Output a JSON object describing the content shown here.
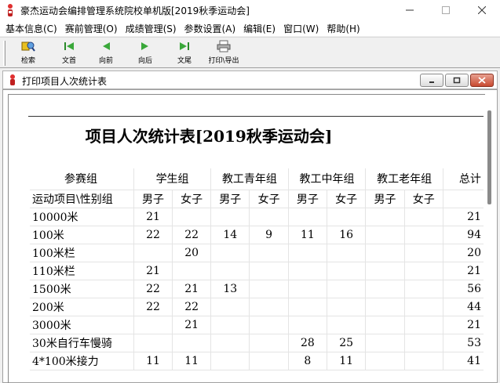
{
  "window": {
    "title": "豪杰运动会编排管理系统院校单机版[2019秋季运动会]"
  },
  "menu": [
    "基本信息(C)",
    "赛前管理(O)",
    "成绩管理(S)",
    "参数设置(A)",
    "编辑(E)",
    "窗口(W)",
    "帮助(H)"
  ],
  "toolbar": {
    "buttons": [
      {
        "label": "检索",
        "icon": "search-icon"
      },
      {
        "label": "文首",
        "icon": "first-record-icon"
      },
      {
        "label": "向前",
        "icon": "previous-icon"
      },
      {
        "label": "向后",
        "icon": "next-icon"
      },
      {
        "label": "文尾",
        "icon": "last-record-icon"
      },
      {
        "label": "打印\\导出",
        "icon": "print-icon"
      }
    ]
  },
  "child": {
    "title": "打印项目人次统计表"
  },
  "report": {
    "title": "项目人次统计表[2019秋季运动会]",
    "header_row1": {
      "corner": "参赛组",
      "groups": [
        "学生组",
        "教工青年组",
        "教工中年组",
        "教工老年组"
      ],
      "total": "总计"
    },
    "header_row2": {
      "corner": "运动项目\\性别组",
      "genders": [
        "男子",
        "女子",
        "男子",
        "女子",
        "男子",
        "女子",
        "男子",
        "女子"
      ]
    },
    "rows": [
      {
        "event": "10000米",
        "cells": [
          "21",
          "",
          "",
          "",
          "",
          "",
          "",
          ""
        ],
        "total": "21"
      },
      {
        "event": "100米",
        "cells": [
          "22",
          "22",
          "14",
          "9",
          "11",
          "16",
          "",
          ""
        ],
        "total": "94"
      },
      {
        "event": "100米栏",
        "cells": [
          "",
          "20",
          "",
          "",
          "",
          "",
          "",
          ""
        ],
        "total": "20"
      },
      {
        "event": "110米栏",
        "cells": [
          "21",
          "",
          "",
          "",
          "",
          "",
          "",
          ""
        ],
        "total": "21"
      },
      {
        "event": "1500米",
        "cells": [
          "22",
          "21",
          "13",
          "",
          "",
          "",
          "",
          ""
        ],
        "total": "56"
      },
      {
        "event": "200米",
        "cells": [
          "22",
          "22",
          "",
          "",
          "",
          "",
          "",
          ""
        ],
        "total": "44"
      },
      {
        "event": "3000米",
        "cells": [
          "",
          "21",
          "",
          "",
          "",
          "",
          "",
          ""
        ],
        "total": "21"
      },
      {
        "event": "30米自行车慢骑",
        "cells": [
          "",
          "",
          "",
          "",
          "28",
          "25",
          "",
          ""
        ],
        "total": "53"
      },
      {
        "event": "4*100米接力",
        "cells": [
          "11",
          "11",
          "",
          "",
          "8",
          "11",
          "",
          ""
        ],
        "total": "41"
      }
    ]
  }
}
